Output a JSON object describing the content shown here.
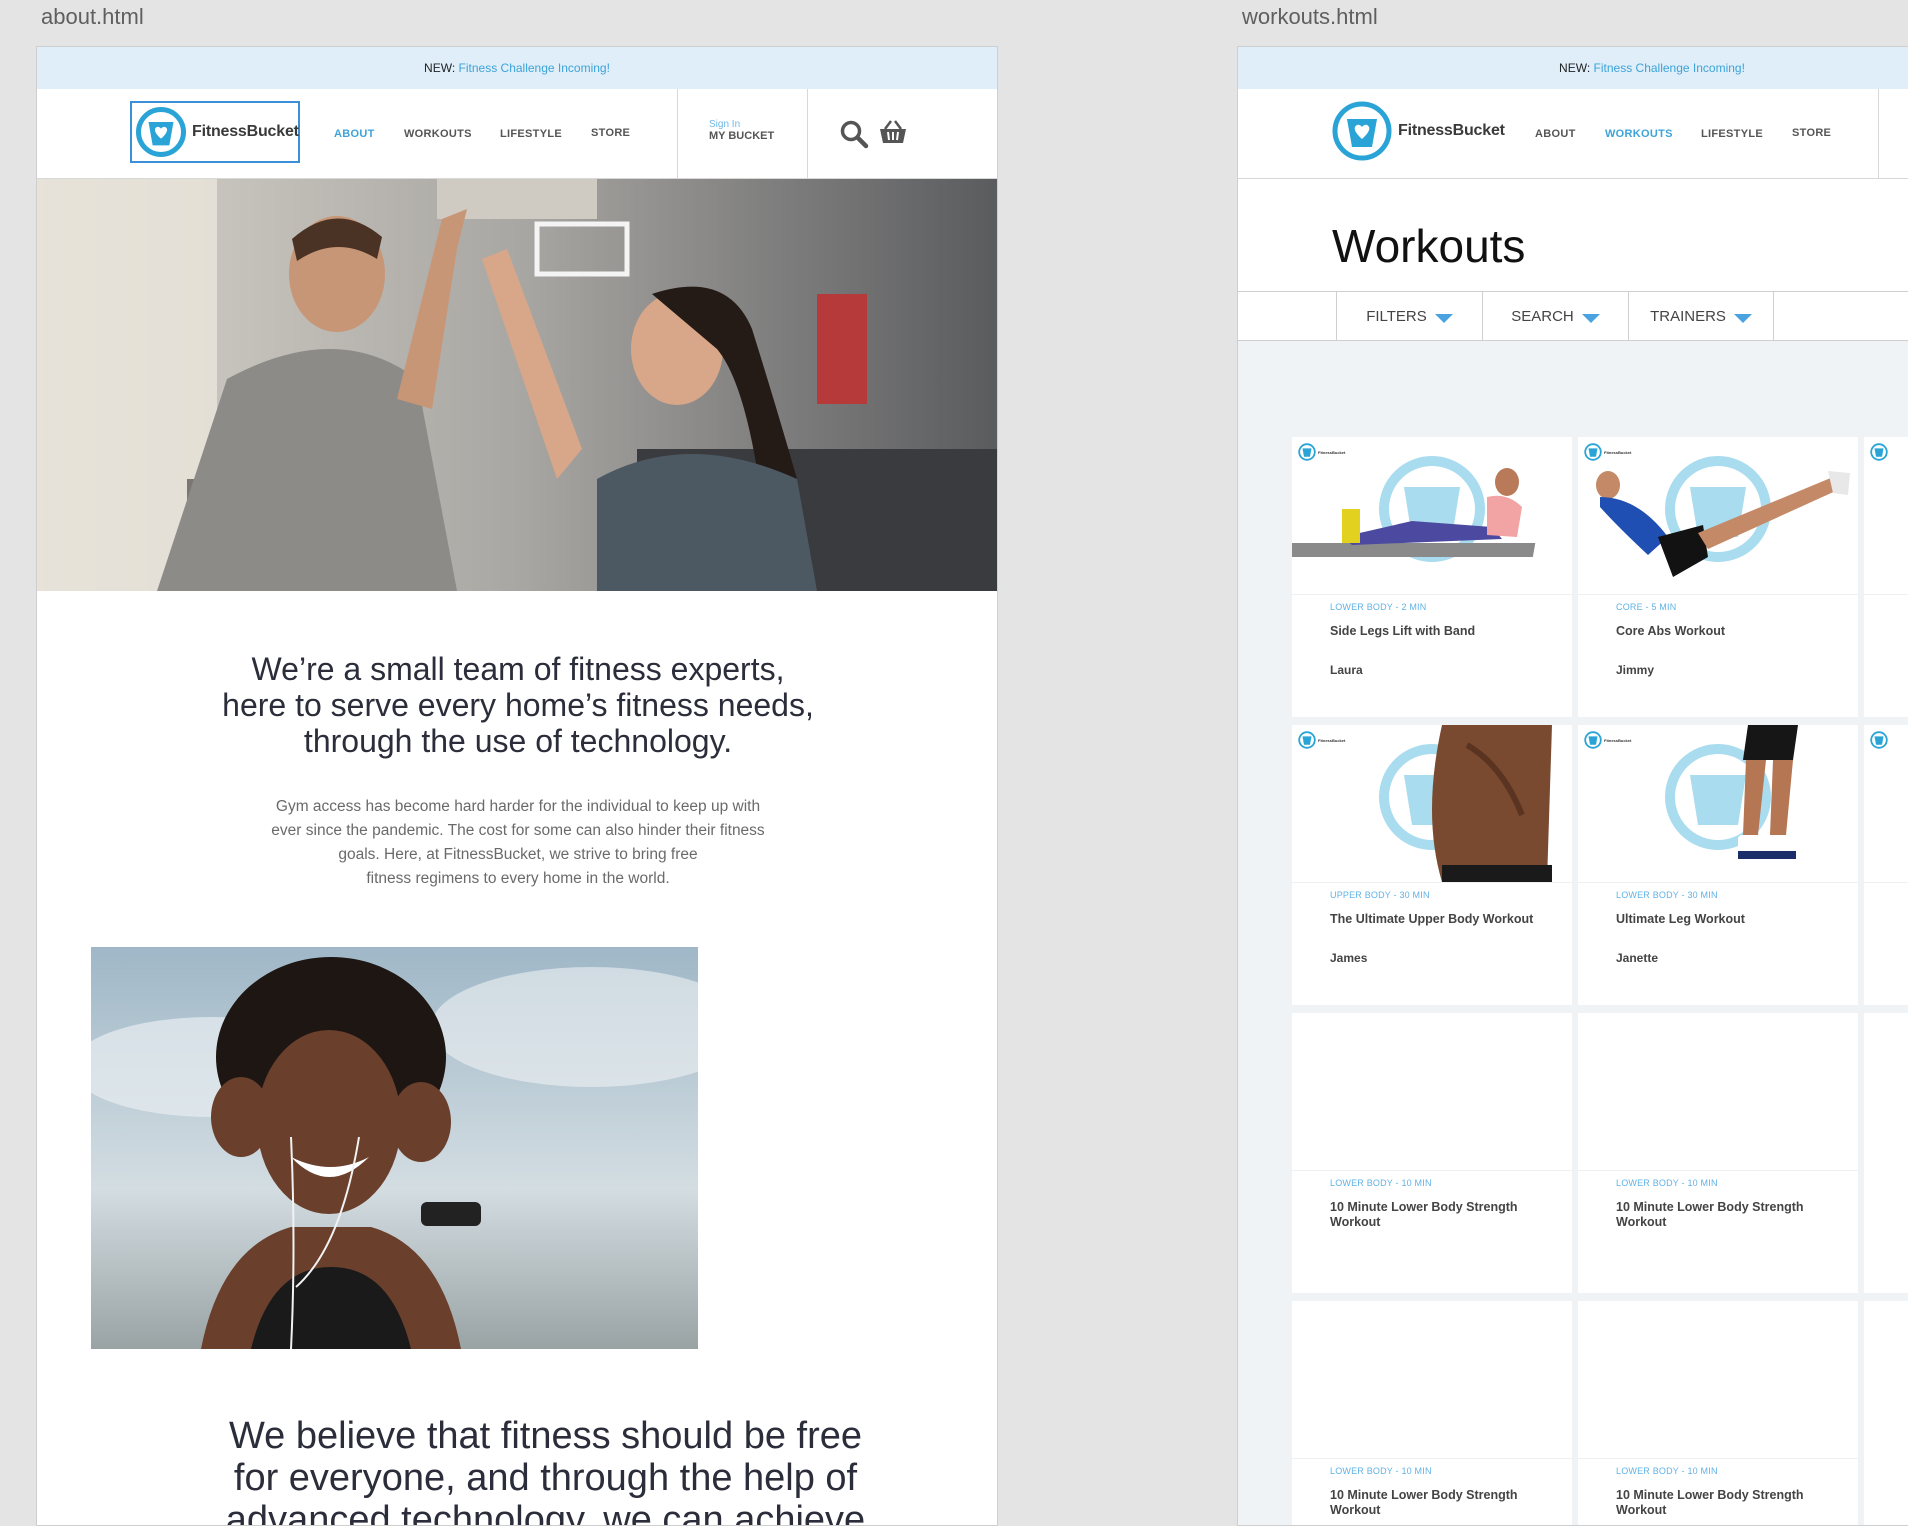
{
  "artboards": {
    "about_label": "about.html",
    "workouts_label": "workouts.html"
  },
  "announce": {
    "prefix": "NEW:",
    "highlight": "Fitness Challenge Incoming!"
  },
  "brand": {
    "name": "FitnessBucket"
  },
  "nav": {
    "about": "ABOUT",
    "workouts": "WORKOUTS",
    "lifestyle": "LIFESTYLE",
    "store": "STORE",
    "sign_in": "Sign In",
    "my_bucket": "MY BUCKET"
  },
  "about_page": {
    "headline": [
      "We’re a small team of fitness experts,",
      "here to serve every home’s fitness needs,",
      "through the use of technology."
    ],
    "body": [
      "Gym access has become hard harder for the individual to keep up with",
      "ever since the pandemic. The cost for some can also hinder their fitness",
      "goals. Here, at FitnessBucket, we strive to bring free",
      "fitness regimens to every home in the world."
    ],
    "headline2": [
      "We believe that fitness should be free",
      "for everyone, and through the help of",
      "advanced technology, we can achieve"
    ]
  },
  "workouts_page": {
    "title": "Workouts",
    "filters": [
      "FILTERS",
      "SEARCH",
      "TRAINERS"
    ],
    "cards": [
      {
        "category": "LOWER BODY - 2 MIN",
        "title": "Side Legs Lift with Band",
        "trainer": "Laura"
      },
      {
        "category": "CORE - 5 MIN",
        "title": "Core Abs Workout",
        "trainer": "Jimmy"
      },
      {
        "category": "UPPER BODY - 30 MIN",
        "title": "The Ultimate Upper Body Workout",
        "trainer": "James"
      },
      {
        "category": "LOWER BODY - 30 MIN",
        "title": "Ultimate Leg Workout",
        "trainer": "Janette"
      },
      {
        "category": "LOWER BODY - 10 MIN",
        "title": "10 Minute Lower Body Strength Workout",
        "trainer": ""
      },
      {
        "category": "LOWER BODY - 10 MIN",
        "title": "10 Minute Lower Body Strength Workout",
        "trainer": ""
      },
      {
        "category": "LOWER BODY - 10 MIN",
        "title": "10 Minute Lower Body Strength Workout",
        "trainer": ""
      },
      {
        "category": "LOWER BODY - 10 MIN",
        "title": "10 Minute Lower Body Strength Workout",
        "trainer": ""
      }
    ]
  },
  "colors": {
    "accent": "#3da3d8",
    "announce_bg": "#dfeef8",
    "heading": "#2b2d3a"
  },
  "icons": [
    "search-icon",
    "basket-icon",
    "bucket-logo-icon",
    "caret-down-icon"
  ]
}
